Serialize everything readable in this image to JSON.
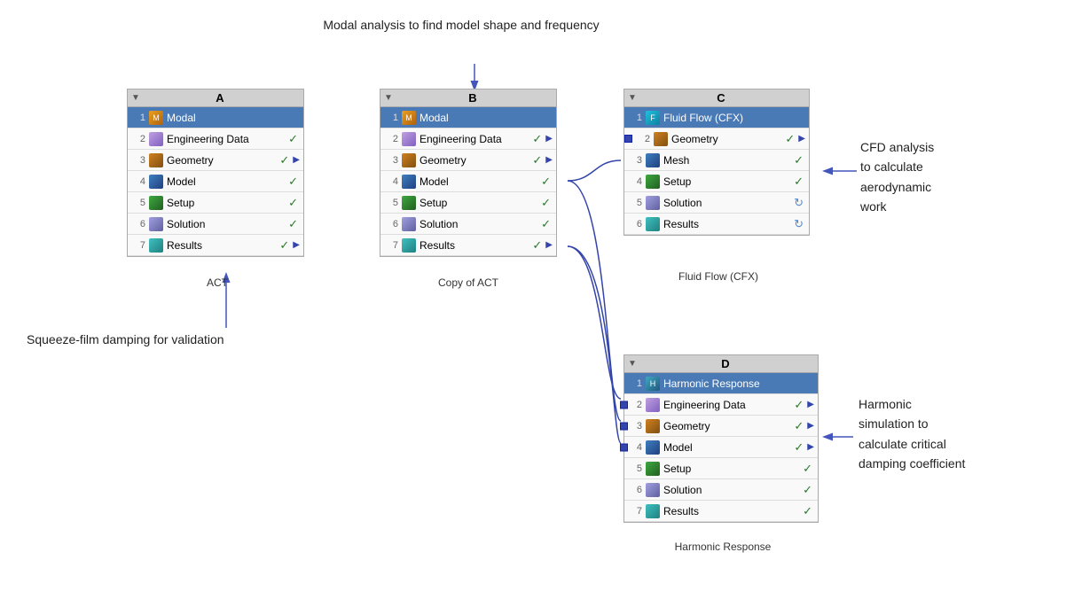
{
  "annotations": {
    "top_label": "Modal analysis to find model shape and frequency",
    "left_label": "Squeeze-film damping for validation",
    "right_cfd_label": "CFD analysis\nto calculate\naerodynamic\nwork",
    "right_harmonic_label": "Harmonic\nsimulation to\ncalculate critical\ndamping coefficient"
  },
  "blocks": {
    "A": {
      "id": "A",
      "title": "A",
      "caption": "ACT",
      "rows": [
        {
          "num": 1,
          "label": "Modal",
          "icon": "modal",
          "check": false,
          "arrow": false,
          "highlight": true
        },
        {
          "num": 2,
          "label": "Engineering Data",
          "icon": "engdata",
          "check": true,
          "arrow": true
        },
        {
          "num": 3,
          "label": "Geometry",
          "icon": "geom",
          "check": true,
          "arrow": true
        },
        {
          "num": 4,
          "label": "Model",
          "icon": "model",
          "check": true,
          "arrow": false
        },
        {
          "num": 5,
          "label": "Setup",
          "icon": "setup",
          "check": true,
          "arrow": false
        },
        {
          "num": 6,
          "label": "Solution",
          "icon": "solution",
          "check": true,
          "arrow": false
        },
        {
          "num": 7,
          "label": "Results",
          "icon": "results",
          "check": true,
          "arrow": true
        }
      ]
    },
    "B": {
      "id": "B",
      "title": "B",
      "caption": "Copy of ACT",
      "rows": [
        {
          "num": 1,
          "label": "Modal",
          "icon": "modal",
          "check": false,
          "arrow": false,
          "highlight": true
        },
        {
          "num": 2,
          "label": "Engineering Data",
          "icon": "engdata",
          "check": true,
          "arrow": true
        },
        {
          "num": 3,
          "label": "Geometry",
          "icon": "geom",
          "check": true,
          "arrow": true
        },
        {
          "num": 4,
          "label": "Model",
          "icon": "model",
          "check": true,
          "arrow": false
        },
        {
          "num": 5,
          "label": "Setup",
          "icon": "setup",
          "check": true,
          "arrow": false
        },
        {
          "num": 6,
          "label": "Solution",
          "icon": "solution",
          "check": true,
          "arrow": false
        },
        {
          "num": 7,
          "label": "Results",
          "icon": "results",
          "check": true,
          "arrow": true
        }
      ]
    },
    "C": {
      "id": "C",
      "title": "C",
      "caption": "Fluid Flow (CFX)",
      "rows": [
        {
          "num": 1,
          "label": "Fluid Flow (CFX)",
          "icon": "fluid",
          "check": false,
          "arrow": false,
          "highlight": true
        },
        {
          "num": 2,
          "label": "Geometry",
          "icon": "geom",
          "check": true,
          "arrow": true
        },
        {
          "num": 3,
          "label": "Mesh",
          "icon": "model",
          "check": true,
          "arrow": false
        },
        {
          "num": 4,
          "label": "Setup",
          "icon": "setup",
          "check": true,
          "arrow": false
        },
        {
          "num": 5,
          "label": "Solution",
          "icon": "solution",
          "check": false,
          "arrow": false,
          "refresh": true
        },
        {
          "num": 6,
          "label": "Results",
          "icon": "results",
          "check": false,
          "arrow": false,
          "refresh": true
        }
      ]
    },
    "D": {
      "id": "D",
      "title": "D",
      "caption": "Harmonic Response",
      "rows": [
        {
          "num": 1,
          "label": "Harmonic Response",
          "icon": "harmonic",
          "check": false,
          "arrow": false,
          "highlight": true
        },
        {
          "num": 2,
          "label": "Engineering Data",
          "icon": "engdata",
          "check": true,
          "arrow": true,
          "connected": true
        },
        {
          "num": 3,
          "label": "Geometry",
          "icon": "geom",
          "check": true,
          "arrow": true,
          "connected": true
        },
        {
          "num": 4,
          "label": "Model",
          "icon": "model",
          "check": true,
          "arrow": false,
          "connected": true
        },
        {
          "num": 5,
          "label": "Setup",
          "icon": "setup",
          "check": true,
          "arrow": false
        },
        {
          "num": 6,
          "label": "Solution",
          "icon": "solution",
          "check": true,
          "arrow": false
        },
        {
          "num": 7,
          "label": "Results",
          "icon": "results",
          "check": true,
          "arrow": false
        }
      ]
    }
  }
}
